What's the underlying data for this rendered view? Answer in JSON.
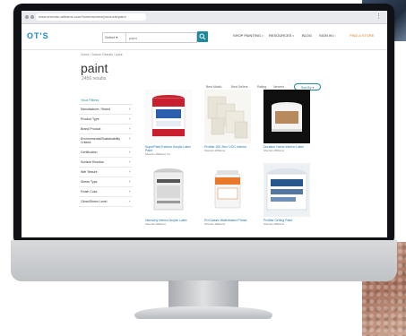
{
  "browser": {
    "url": "www.sherwin-williams.com/homeowners/products/paint",
    "menu_glyph": "⋮"
  },
  "site": {
    "logo_text": "OT'S",
    "brand_color": "#1d8a9e",
    "search": {
      "select_label": "Select ▾",
      "placeholder": "paint",
      "icon": "search-icon"
    },
    "nav": [
      {
        "label": "SHOP PAINTING"
      },
      {
        "label": "RESOURCES"
      },
      {
        "label": "BLOG"
      },
      {
        "label": "SIGN IN"
      },
      {
        "label": "FIND A STORE"
      }
    ]
  },
  "page": {
    "breadcrumb": "Home / Search Results / paint",
    "title": "paint",
    "results": "2456 results",
    "sort_options": [
      "Best Match",
      "Best Sellers",
      "Rating",
      "Newest"
    ],
    "sort_button": "Sort By ▾"
  },
  "sidebar": {
    "title": "Your Filters",
    "facets": [
      "Manufacturer / Brand",
      "Product Type",
      "Brand Product",
      "Environmental/Sustainability Criteria",
      "Certification",
      "Surface Residue",
      "Wet Texture",
      "Sheen Type",
      "Finish Color",
      "Gloss/Sheen Level"
    ]
  },
  "products": [
    {
      "name": "SuperPaint Exterior Acrylic Latex Paint",
      "meta": "Sherwin-Williams Co.",
      "accent": "#c8202e"
    },
    {
      "name": "ProMar 200 Zero VOC Interior",
      "meta": "Sherwin-Williams",
      "accent": "#e6e1d6"
    },
    {
      "name": "Duration Home Interior Latex",
      "meta": "Sherwin-Williams",
      "accent": "#b8895a"
    },
    {
      "name": "Harmony Interior Acrylic Latex",
      "meta": "Sherwin-Williams",
      "accent": "#d9d9d9"
    },
    {
      "name": "ProClassic Waterbased Primer",
      "meta": "Sherwin-Williams",
      "accent": "#e8792a"
    },
    {
      "name": "ProMar Ceiling Paint",
      "meta": "Sherwin-Williams",
      "accent": "#27568a"
    }
  ]
}
